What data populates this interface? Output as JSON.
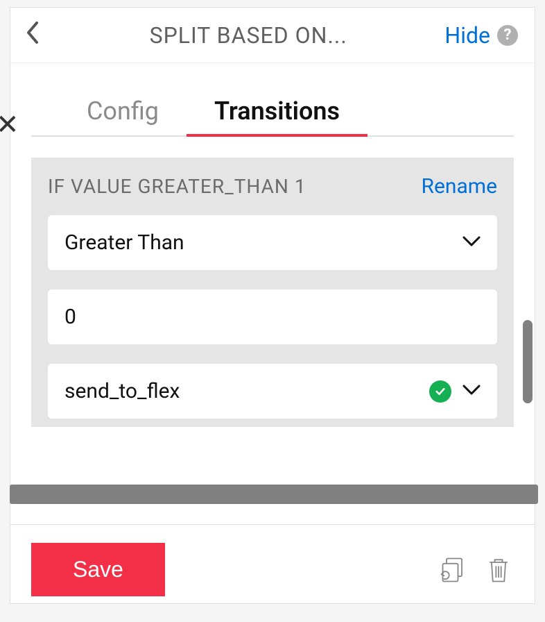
{
  "header": {
    "title": "SPLIT BASED ON...",
    "hide_label": "Hide"
  },
  "tabs": {
    "config_label": "Config",
    "transitions_label": "Transitions"
  },
  "condition": {
    "label": "IF VALUE GREATER_THAN 1",
    "rename_label": "Rename",
    "operator": "Greater Than",
    "value": "0",
    "destination": "send_to_flex"
  },
  "footer": {
    "save_label": "Save"
  }
}
